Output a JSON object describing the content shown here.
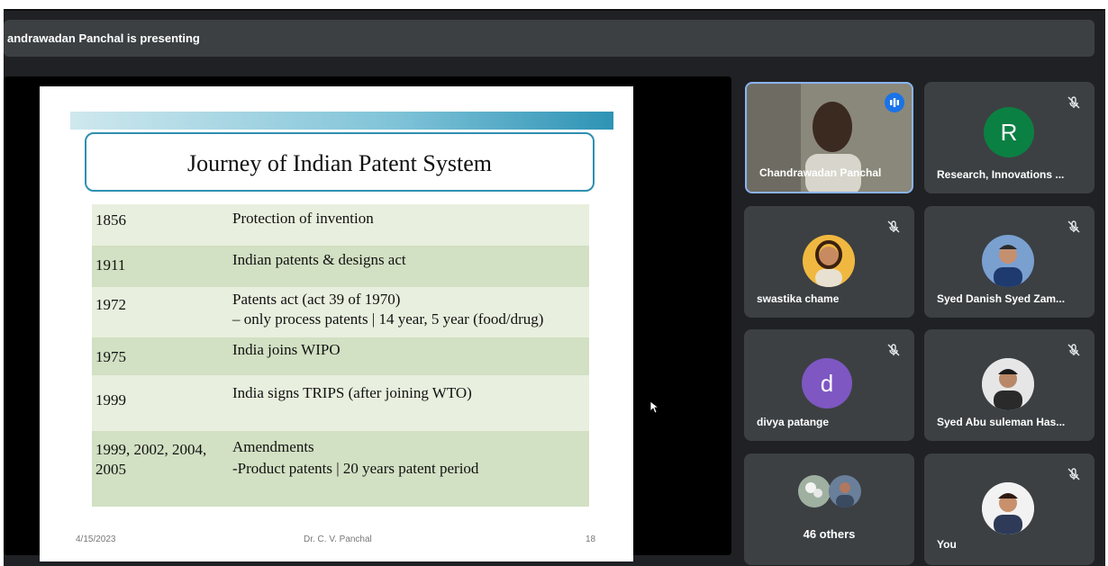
{
  "presenting_text": "andrawadan Panchal is presenting",
  "slide": {
    "title": "Journey of Indian Patent System",
    "rows": [
      {
        "year": "1856",
        "event": "Protection of invention",
        "event2": ""
      },
      {
        "year": "1911",
        "event": "Indian patents & designs act",
        "event2": ""
      },
      {
        "year": "1972",
        "event": "Patents act (act 39 of 1970)",
        "event2": "– only process patents | 14 year, 5 year (food/drug)"
      },
      {
        "year": "1975",
        "event": "India joins WIPO",
        "event2": ""
      },
      {
        "year": "1999",
        "event": "India signs TRIPS (after joining WTO)",
        "event2": ""
      },
      {
        "year": "1999, 2002, 2004, 2005",
        "event": "Amendments",
        "event2": "-Product patents | 20 years patent period"
      }
    ],
    "footer_date": "4/15/2023",
    "footer_author": "Dr. C. V. Panchal",
    "footer_page": "18"
  },
  "participants": {
    "presenter": {
      "name": "Chandrawadan Panchal"
    },
    "r_tile": {
      "name": "Research, Innovations ...",
      "initial": "R",
      "color": "#0b8043"
    },
    "swastika": {
      "name": "swastika chame"
    },
    "syed_danish": {
      "name": "Syed Danish Syed Zam..."
    },
    "divya": {
      "name": "divya patange",
      "initial": "d",
      "color": "#7e57c2"
    },
    "syed_abu": {
      "name": "Syed Abu suleman Has..."
    },
    "others": {
      "name": "46 others"
    },
    "you": {
      "name": "You"
    }
  },
  "colors": {
    "tile": "#3c4043",
    "presenter_border": "#8ab4f8",
    "speaking_badge": "#1a73e8"
  }
}
